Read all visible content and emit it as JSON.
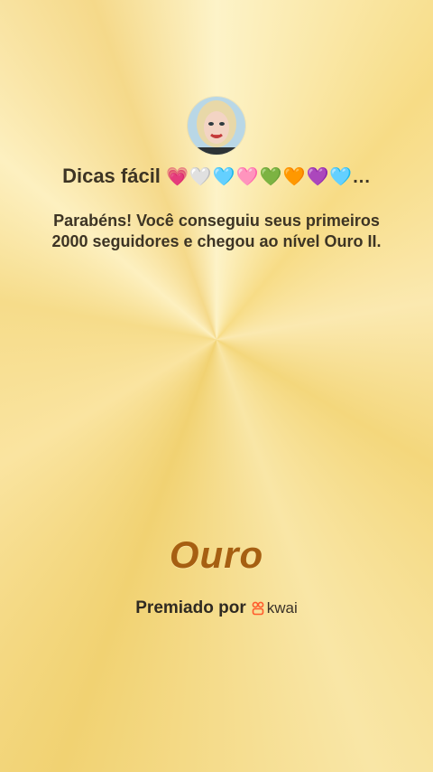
{
  "profile": {
    "username": "Dicas fácil ",
    "hearts": "💗🤍🩵🩷💚🧡💜🩵...",
    "avatar_icon": "user-avatar"
  },
  "message": "Parabéns! Você conseguiu seus primeiros 2000 seguidores e chegou ao nível Ouro II.",
  "level": "Ouro",
  "award": {
    "prefix": "Premiado por",
    "brand": "kwai",
    "brand_color": "#ff5a2c"
  },
  "colors": {
    "background": "#f7dc86",
    "level_text": "#a65f12",
    "text": "#3d3424"
  }
}
